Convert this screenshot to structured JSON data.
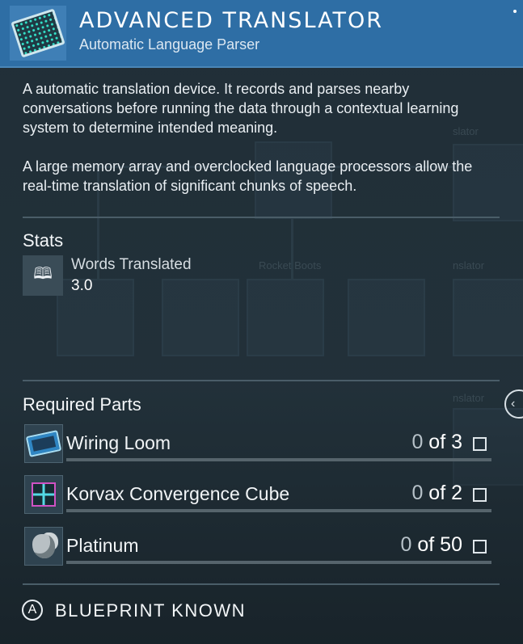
{
  "header": {
    "title": "ADVANCED TRANSLATOR",
    "subtitle": "Automatic Language Parser",
    "icon": "translator-chip-icon"
  },
  "description": {
    "paragraph_1": "A automatic translation device. It records and parses nearby conversations before running the data through a contextual learning system to determine intended meaning.",
    "paragraph_2": "A large memory array and overclocked language processors allow the real-time translation of significant chunks of speech."
  },
  "stats": {
    "heading": "Stats",
    "items": [
      {
        "label": "Words Translated",
        "value": "3.0",
        "icon": "book-icon"
      }
    ]
  },
  "required_parts": {
    "heading": "Required Parts",
    "items": [
      {
        "name": "Wiring Loom",
        "have": "0",
        "of_label": "of 3",
        "progress": 0,
        "icon": "wiring-loom-icon"
      },
      {
        "name": "Korvax Convergence Cube",
        "have": "0",
        "of_label": "of 2",
        "progress": 0,
        "icon": "convergence-cube-icon"
      },
      {
        "name": "Platinum",
        "have": "0",
        "of_label": "of 50",
        "progress": 0,
        "icon": "platinum-icon"
      }
    ]
  },
  "footer": {
    "button_glyph": "A",
    "label": "BLUEPRINT KNOWN"
  },
  "colors": {
    "header_bg": "#2e6ea5",
    "panel_bg": "#263640",
    "text": "#e9eef2"
  }
}
